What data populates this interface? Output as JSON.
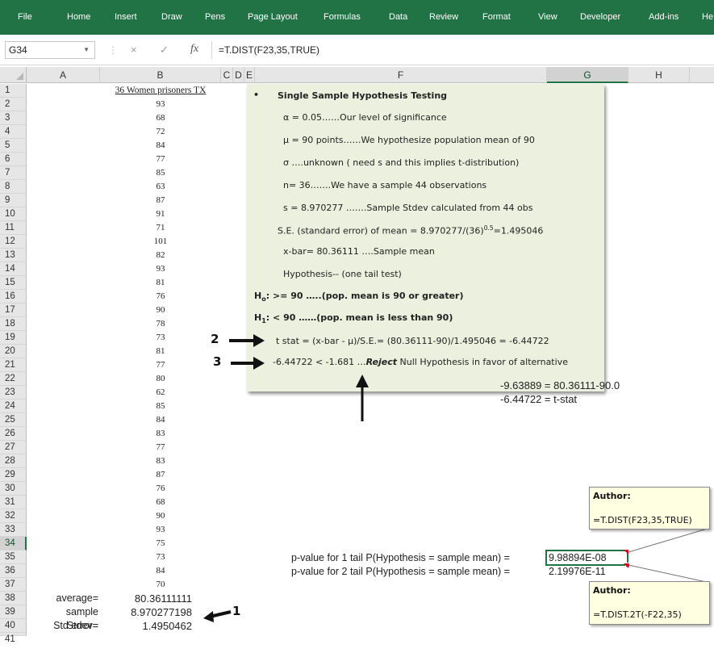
{
  "ribbon": {
    "tabs": [
      "File",
      "Home",
      "Insert",
      "Draw",
      "Pens",
      "Page Layout",
      "Formulas",
      "Data",
      "Review",
      "Format",
      "View",
      "Developer",
      "Add-ins",
      "He"
    ]
  },
  "formula_bar": {
    "cell_ref": "G34",
    "fx": "fx",
    "formula": "=T.DIST(F23,35,TRUE)",
    "cancel": "×",
    "enter": "✓"
  },
  "columns": [
    "A",
    "B",
    "C",
    "D",
    "E",
    "F",
    "G",
    "H"
  ],
  "rows": [
    "1",
    "2",
    "3",
    "4",
    "5",
    "6",
    "7",
    "8",
    "9",
    "10",
    "11",
    "12",
    "13",
    "14",
    "15",
    "16",
    "17",
    "18",
    "19",
    "20",
    "21",
    "22",
    "23",
    "24",
    "25",
    "26",
    "27",
    "28",
    "29",
    "30",
    "31",
    "32",
    "33",
    "34",
    "35",
    "36",
    "37",
    "38",
    "39",
    "40",
    "41"
  ],
  "col_b": {
    "header": "36 Women prisoners TX",
    "values": [
      "93",
      "68",
      "72",
      "84",
      "77",
      "85",
      "63",
      "87",
      "91",
      "71",
      "101",
      "82",
      "93",
      "81",
      "76",
      "90",
      "78",
      "73",
      "81",
      "77",
      "80",
      "62",
      "85",
      "84",
      "83",
      "77",
      "83",
      "87",
      "76",
      "68",
      "90",
      "93",
      "75",
      "73",
      "84",
      "70"
    ]
  },
  "stats": [
    {
      "label": "average=",
      "value": "80.36111111"
    },
    {
      "label": "sample Stdev=",
      "value": "8.970277198"
    },
    {
      "label": "Std error=",
      "value": "1.4950462"
    }
  ],
  "panel": {
    "bullet": "•",
    "title": "Single Sample Hypothesis Testing",
    "alpha": "α = 0.05……Our level of significance",
    "mu": "μ =  90 points……We hypothesize population mean of 90",
    "sigma": "σ ….unknown ( need s and this implies t-distribution)",
    "n": "n= 36…….We have a sample 44 observations",
    "s": "s = 8.970277 …….Sample Stdev calculated from 44 obs",
    "se": "S.E. (standard error) of mean = 8.970277/(36)",
    "se_sup": "0.5",
    "se_tail": "=1.495046",
    "xbar": "x-bar=  80.36111 ….Sample mean",
    "hyp": "Hypothesis-- (one tail test)",
    "h0_main": "H",
    "h0_sub": "o",
    "h0_rest": ":  >= 90 …..(pop. mean is 90 or greater)",
    "h1_main": "H",
    "h1_sub": "1",
    "h1_rest": ":  < 90 ……(pop. mean is less than 90)",
    "tstat": "t stat = (x-bar - μ)/S.E.=  (80.36111-90)/1.495046 = -6.44722",
    "reject_pre": "-6.44722 < -1.681  …",
    "reject_word": "Reject",
    "reject_post": " Null Hypothesis in favor of alternative"
  },
  "calc": {
    "line1": "-9.63889 = 80.36111-90.0",
    "line2": "-6.44722 = t-stat"
  },
  "pvalues": {
    "one_label": "p-value for 1 tail  P(Hypothesis = sample mean) =",
    "one_value": "9.98894E-08",
    "two_label": "p-value for 2 tail  P(Hypothesis = sample mean) =",
    "two_value": "2.19976E-11"
  },
  "notes": [
    {
      "author": "Author:",
      "formula": "=T.DIST(F23,35,TRUE)"
    },
    {
      "author": "Author:",
      "formula": "=T.DIST.2T(-F22,35)"
    }
  ],
  "annotations": {
    "one": "1",
    "two": "2",
    "three": "3"
  }
}
